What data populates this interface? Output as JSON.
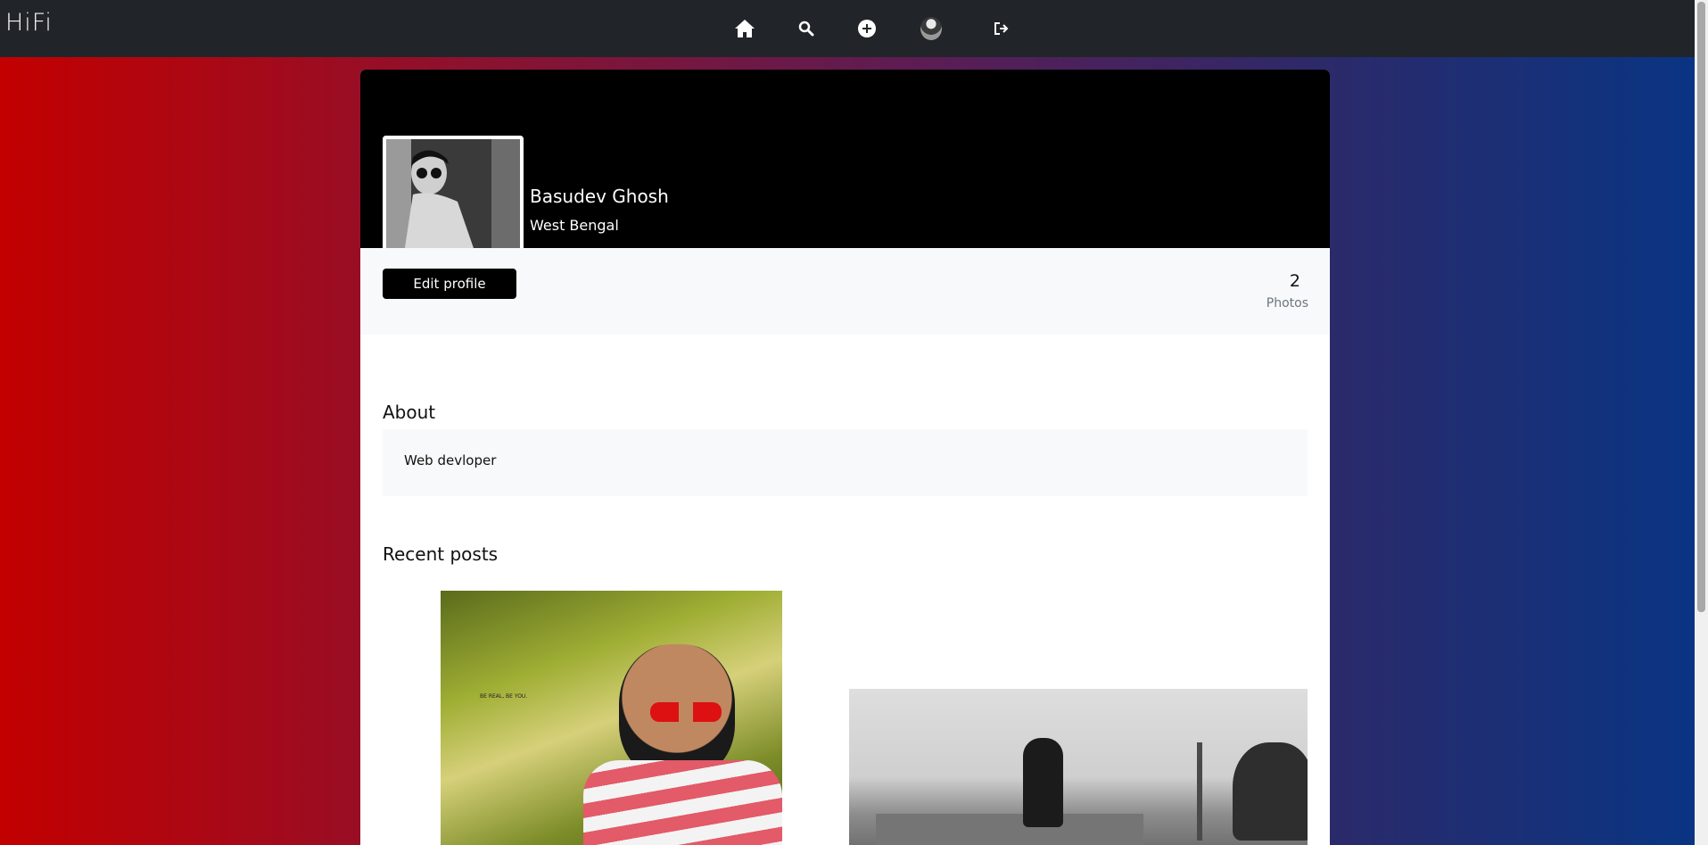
{
  "nav": {
    "brand": "HiFi",
    "icons": [
      "home-icon",
      "search-icon",
      "add-post-icon",
      "profile-avatar",
      "logout-icon"
    ]
  },
  "profile": {
    "name": "Basudev Ghosh",
    "location": "West Bengal",
    "edit_label": "Edit profile",
    "photo_count": "2",
    "photo_label": "Photos"
  },
  "about": {
    "heading": "About",
    "text": "Web devloper"
  },
  "posts": {
    "heading": "Recent posts",
    "items": [
      {
        "caption": "BE REAL, BE YOU."
      },
      {
        "caption": ""
      }
    ]
  },
  "colors": {
    "navbar": "#212529",
    "gradient_left": "#c20000",
    "gradient_right": "#083584",
    "cover": "#000000"
  }
}
